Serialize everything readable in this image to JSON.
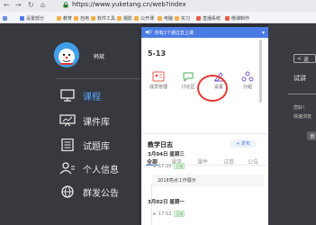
{
  "browser": {
    "url": "https://www.yuketang.cn/web?index",
    "bookmarks": [
      {
        "label": "设置部分",
        "color": "#4b7ce3"
      },
      {
        "label": "教育",
        "color": "#f3b04a"
      },
      {
        "label": "自用",
        "color": "#f3b04a"
      },
      {
        "label": "软件工具",
        "color": "#f3b04a"
      },
      {
        "label": "摄影",
        "color": "#f3b04a"
      },
      {
        "label": "公开课",
        "color": "#f3b04a"
      },
      {
        "label": "电脑",
        "color": "#f3b04a"
      },
      {
        "label": "实习",
        "color": "#f3b04a"
      },
      {
        "label": "直播系统",
        "color": "#e85c4a"
      },
      {
        "label": "微课制作",
        "color": "#e85c4a"
      }
    ]
  },
  "sidebar": {
    "username": "韩斌",
    "items": [
      {
        "label": "课程",
        "icon": "screen-icon",
        "active": true
      },
      {
        "label": "课件库",
        "icon": "presentation-icon",
        "active": false
      },
      {
        "label": "试题库",
        "icon": "list-icon",
        "active": false
      },
      {
        "label": "个人信息",
        "icon": "person-icon",
        "active": false
      },
      {
        "label": "群发公告",
        "icon": "globe-icon",
        "active": false
      }
    ]
  },
  "panel": {
    "header_msg": "你有1个通过去上课",
    "class_title": "5-13",
    "actions": [
      {
        "label": "成员管理",
        "icon": "members-icon"
      },
      {
        "label": "讨论区",
        "icon": "discussion-icon"
      },
      {
        "label": "设置",
        "icon": "settings-icon"
      },
      {
        "label": "分组",
        "icon": "group-icon"
      }
    ],
    "log_title": "教学日志",
    "new_button": "+ 发布",
    "tabs": [
      "全部",
      "课堂",
      "课件",
      "试卷",
      "公告"
    ],
    "entries": [
      {
        "date": "3月04日 星期三",
        "time": "17:20",
        "tag": "已结",
        "card": "2018亮点工作展示"
      },
      {
        "date": "3月02日 星期一",
        "time": "17:52",
        "tag": "已结",
        "card": ""
      }
    ]
  },
  "right": {
    "back_label": "返",
    "title": "试讲",
    "text_lines": [
      "您好！",
      "快速浏览"
    ],
    "cta": "创"
  }
}
